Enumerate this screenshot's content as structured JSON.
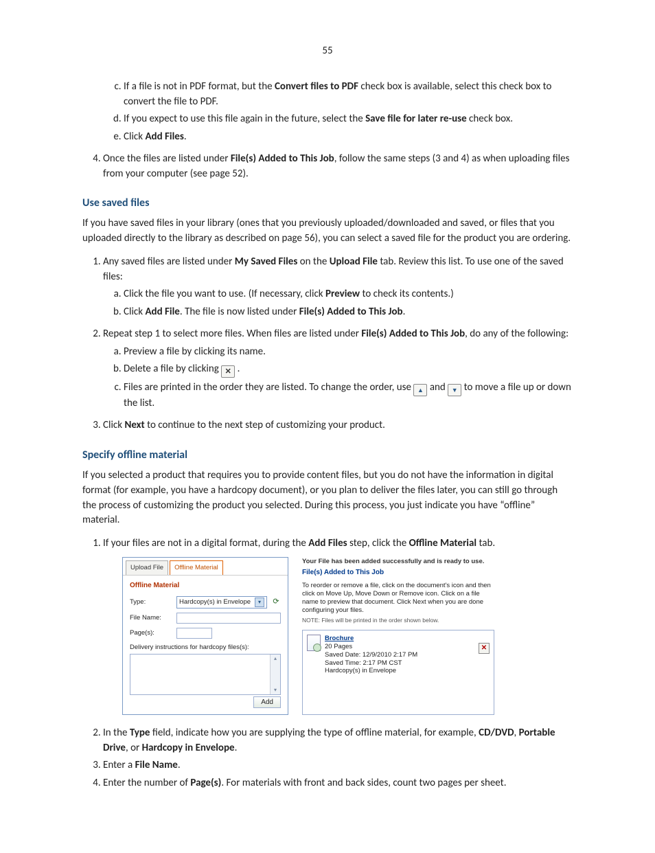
{
  "page_number": "55",
  "list_c": {
    "prefix": "If a file is not in PDF format, but the ",
    "bold1": "Convert files to PDF",
    "suffix": " check box is available, select this check box to convert the file to PDF."
  },
  "list_d": {
    "prefix": "If you expect to use this file again in the future, select the ",
    "bold1": "Save file for later re-use",
    "suffix": " check box."
  },
  "list_e": {
    "prefix": "Click ",
    "bold1": "Add Files",
    "suffix": "."
  },
  "step4": {
    "prefix": "Once the files are listed under ",
    "bold1": "File(s) Added to This Job",
    "suffix": ", follow the same steps (3 and 4) as when uploading files from your computer (see page 52)."
  },
  "h_saved": "Use saved files",
  "p_saved_intro": "If you have saved files in your library (ones that you previously uploaded/downloaded and saved, or files that you uploaded directly to the library as described on page 56), you can select a saved file for the product you are ordering.",
  "saved1": {
    "prefix": "Any saved files are listed under ",
    "bold1": "My Saved Files",
    "mid": " on the ",
    "bold2": "Upload File",
    "suffix": " tab. Review this list. To use one of the saved files:"
  },
  "saved1a": {
    "prefix": "Click the file you want to use. (If necessary, click ",
    "bold1": "Preview",
    "suffix": " to check its contents.)"
  },
  "saved1b": {
    "prefix": "Click ",
    "bold1": "Add File",
    "mid": ". The file is now listed under ",
    "bold2": "File(s) Added to This Job",
    "suffix": "."
  },
  "saved2": {
    "prefix": "Repeat step 1 to select more files. When files are listed under ",
    "bold1": "File(s) Added to This Job",
    "suffix": ", do any of the following:"
  },
  "saved2a": "Preview a file by clicking its name.",
  "saved2b_prefix": "Delete a file by clicking ",
  "saved2b_suffix": ".",
  "saved2c_prefix": "Files are printed in the order they are listed. To change the order, use ",
  "saved2c_mid": "and ",
  "saved2c_suffix": "to move a file up or down the list.",
  "saved3": {
    "prefix": "Click ",
    "bold1": "Next",
    "suffix": " to continue to the next step of customizing your product."
  },
  "h_offline": "Specify offline material",
  "p_offline_intro": "If you selected a product that requires you to provide content files, but you do not have the information in digital format (for example, you have a hardcopy document), or you plan to deliver the files later, you can still go through the process of customizing the product you selected. During this process, you just indicate you have “offline” material.",
  "off1": {
    "prefix": "If your files are not in a digital format, during the ",
    "bold1": "Add Files",
    "mid": " step, click the ",
    "bold2": "Offline Material",
    "suffix": " tab."
  },
  "fig": {
    "tab_upload": "Upload File",
    "tab_offline": "Offline Material",
    "om_title": "Offline Material",
    "lbl_type": "Type:",
    "type_value": "Hardcopy(s) in Envelope",
    "lbl_filename": "File Name:",
    "lbl_pages": "Page(s):",
    "lbl_delivery": "Delivery instructions for hardcopy files(s):",
    "btn_add": "Add",
    "success": "Your File has been added successfully and is ready to use.",
    "right_title": "File(s) Added to This Job",
    "right_para": "To reorder or remove a file, click on the document's icon and then click on Move Up, Move Down or Remove icon. Click on a file name to preview that document. Click Next when you are done configuring your files.",
    "right_note": "NOTE: Files will be printed in the order shown below.",
    "file": {
      "name": "Brochure",
      "pages": "20 Pages",
      "saved_date": "Saved Date: 12/9/2010 2:17 PM",
      "saved_time": "Saved Time: 2:17 PM CST",
      "type": "Hardcopy(s) in Envelope"
    }
  },
  "off2": {
    "prefix": "In the ",
    "bold1": "Type",
    "mid": " field, indicate how you are supplying the type of offline material, for example, ",
    "bold2": "CD/DVD",
    "sep1": ", ",
    "bold3": "Portable Drive",
    "sep2": ", or ",
    "bold4": "Hardcopy in Envelope",
    "suffix": "."
  },
  "off3": {
    "prefix": "Enter a ",
    "bold1": "File Name",
    "suffix": "."
  },
  "off4": {
    "prefix": "Enter the number of ",
    "bold1": "Page(s)",
    "suffix": ". For materials with front and back sides, count two pages per sheet."
  }
}
